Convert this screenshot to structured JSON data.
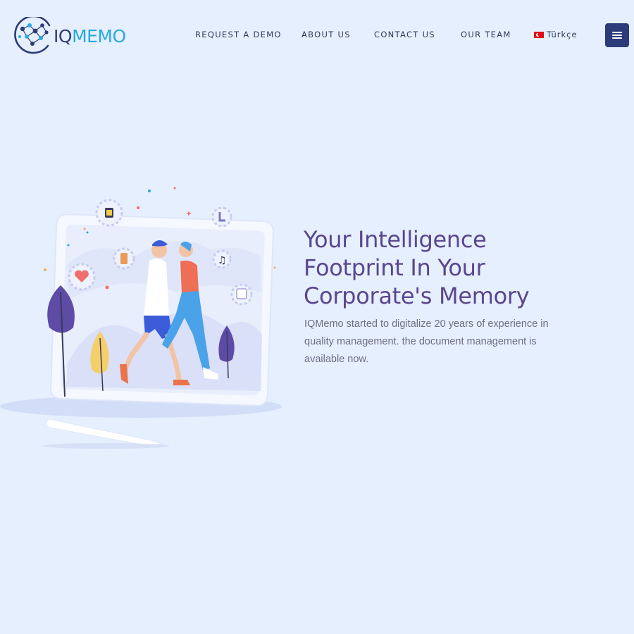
{
  "header": {
    "logo": {
      "prefix": "IQ",
      "suffix": "MEMO"
    },
    "nav": [
      {
        "label": "REQUEST A DEMO"
      },
      {
        "label": "ABOUT US"
      },
      {
        "label": "CONTACT US"
      },
      {
        "label": "OUR TEAM"
      }
    ],
    "language": {
      "label": "Türkçe",
      "flag_icon": "turkey-flag-icon"
    },
    "menu_icon": "hamburger-menu-icon"
  },
  "hero": {
    "title_lines": [
      "Your Intelligence",
      "Footprint In Your",
      "Corporate's Memory"
    ],
    "description": "IQMemo started to digitalize 20 years of experience in quality management. the document management is available now."
  },
  "colors": {
    "background": "#e6effe",
    "brand_dark": "#2c3b79",
    "brand_light": "#29a8e0",
    "title": "#5a468f",
    "nav_text": "#2e3a5c",
    "body_text": "#6e6e84"
  }
}
